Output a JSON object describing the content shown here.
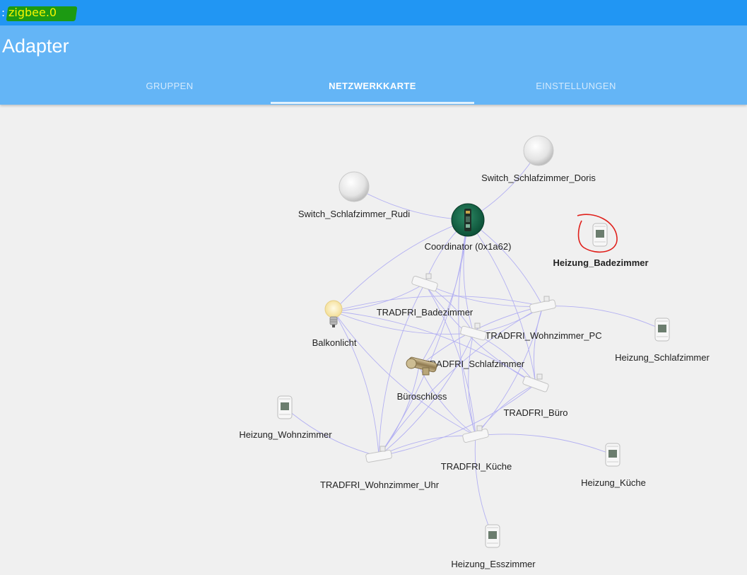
{
  "window": {
    "prefix": ":",
    "title": "zigbee.0"
  },
  "header": {
    "title": "Adapter"
  },
  "tabs": [
    {
      "label": "GRUPPEN",
      "active": false
    },
    {
      "label": "NETZWERKKARTE",
      "active": true
    },
    {
      "label": "EINSTELLUNGEN",
      "active": false
    }
  ],
  "network": {
    "nodes": {
      "coordinator": {
        "label": "Coordinator (0x1a62)",
        "icon": "coordinator-icon"
      },
      "switch_doris": {
        "label": "Switch_Schlafzimmer_Doris",
        "icon": "switch-icon"
      },
      "switch_rudi": {
        "label": "Switch_Schlafzimmer_Rudi",
        "icon": "switch-icon"
      },
      "heizung_badezimmer": {
        "label": "Heizung_Badezimmer",
        "icon": "thermostat-icon",
        "highlighted": true
      },
      "tradfri_badezimmer": {
        "label": "TRADFRI_Badezimmer",
        "icon": "repeater-icon"
      },
      "balkonlicht": {
        "label": "Balkonlicht",
        "icon": "bulb-icon"
      },
      "tradfri_wohnzimmer_pc": {
        "label": "TRADFRI_Wohnzimmer_PC",
        "icon": "repeater-icon"
      },
      "heizung_schlafzimmer": {
        "label": "Heizung_Schlafzimmer",
        "icon": "thermostat-icon"
      },
      "tradfri_schlafzimmer": {
        "label": "TRADFRI_Schlafzimmer",
        "icon": "repeater-icon"
      },
      "bueroschloss": {
        "label": "Büroschloss",
        "icon": "lock-cylinder-icon"
      },
      "tradfri_buero": {
        "label": "TRADFRI_Büro",
        "icon": "repeater-icon"
      },
      "heizung_wohnzimmer": {
        "label": "Heizung_Wohnzimmer",
        "icon": "thermostat-icon"
      },
      "tradfri_kueche": {
        "label": "TRADFRI_Küche",
        "icon": "repeater-icon"
      },
      "heizung_kueche": {
        "label": "Heizung_Küche",
        "icon": "thermostat-icon"
      },
      "tradfri_wohnzimmer_uhr": {
        "label": "TRADFRI_Wohnzimmer_Uhr",
        "icon": "repeater-icon"
      },
      "heizung_esszimmer": {
        "label": "Heizung_Esszimmer",
        "icon": "thermostat-icon"
      }
    },
    "links": [
      [
        "coordinator",
        "switch_doris"
      ],
      [
        "coordinator",
        "switch_rudi"
      ],
      [
        "coordinator",
        "tradfri_badezimmer"
      ],
      [
        "coordinator",
        "tradfri_wohnzimmer_pc"
      ],
      [
        "coordinator",
        "tradfri_schlafzimmer"
      ],
      [
        "coordinator",
        "tradfri_buero"
      ],
      [
        "coordinator",
        "tradfri_kueche"
      ],
      [
        "coordinator",
        "tradfri_wohnzimmer_uhr"
      ],
      [
        "coordinator",
        "balkonlicht"
      ],
      [
        "coordinator",
        "bueroschloss"
      ],
      [
        "balkonlicht",
        "tradfri_badezimmer"
      ],
      [
        "balkonlicht",
        "tradfri_wohnzimmer_pc"
      ],
      [
        "balkonlicht",
        "tradfri_schlafzimmer"
      ],
      [
        "balkonlicht",
        "tradfri_buero"
      ],
      [
        "balkonlicht",
        "tradfri_kueche"
      ],
      [
        "balkonlicht",
        "tradfri_wohnzimmer_uhr"
      ],
      [
        "tradfri_badezimmer",
        "tradfri_wohnzimmer_pc"
      ],
      [
        "tradfri_badezimmer",
        "tradfri_schlafzimmer"
      ],
      [
        "tradfri_badezimmer",
        "tradfri_buero"
      ],
      [
        "tradfri_badezimmer",
        "tradfri_kueche"
      ],
      [
        "tradfri_badezimmer",
        "tradfri_wohnzimmer_uhr"
      ],
      [
        "tradfri_wohnzimmer_pc",
        "tradfri_schlafzimmer"
      ],
      [
        "tradfri_wohnzimmer_pc",
        "tradfri_buero"
      ],
      [
        "tradfri_wohnzimmer_pc",
        "tradfri_kueche"
      ],
      [
        "tradfri_wohnzimmer_pc",
        "tradfri_wohnzimmer_uhr"
      ],
      [
        "tradfri_wohnzimmer_pc",
        "heizung_schlafzimmer"
      ],
      [
        "tradfri_wohnzimmer_pc",
        "bueroschloss"
      ],
      [
        "tradfri_schlafzimmer",
        "tradfri_buero"
      ],
      [
        "tradfri_schlafzimmer",
        "tradfri_kueche"
      ],
      [
        "tradfri_schlafzimmer",
        "tradfri_wohnzimmer_uhr"
      ],
      [
        "tradfri_buero",
        "tradfri_kueche"
      ],
      [
        "tradfri_buero",
        "tradfri_wohnzimmer_uhr"
      ],
      [
        "tradfri_kueche",
        "tradfri_wohnzimmer_uhr"
      ],
      [
        "tradfri_kueche",
        "heizung_kueche"
      ],
      [
        "tradfri_kueche",
        "heizung_esszimmer"
      ],
      [
        "tradfri_wohnzimmer_uhr",
        "heizung_wohnzimmer"
      ],
      [
        "bueroschloss",
        "tradfri_kueche"
      ],
      [
        "bueroschloss",
        "tradfri_wohnzimmer_uhr"
      ]
    ]
  },
  "colors": {
    "titlebar": "#2196f3",
    "appbar": "#64b5f6",
    "link": "#b3b0f2",
    "highlight_circle": "#e0201b",
    "title_highlight": "#1c9a12"
  }
}
